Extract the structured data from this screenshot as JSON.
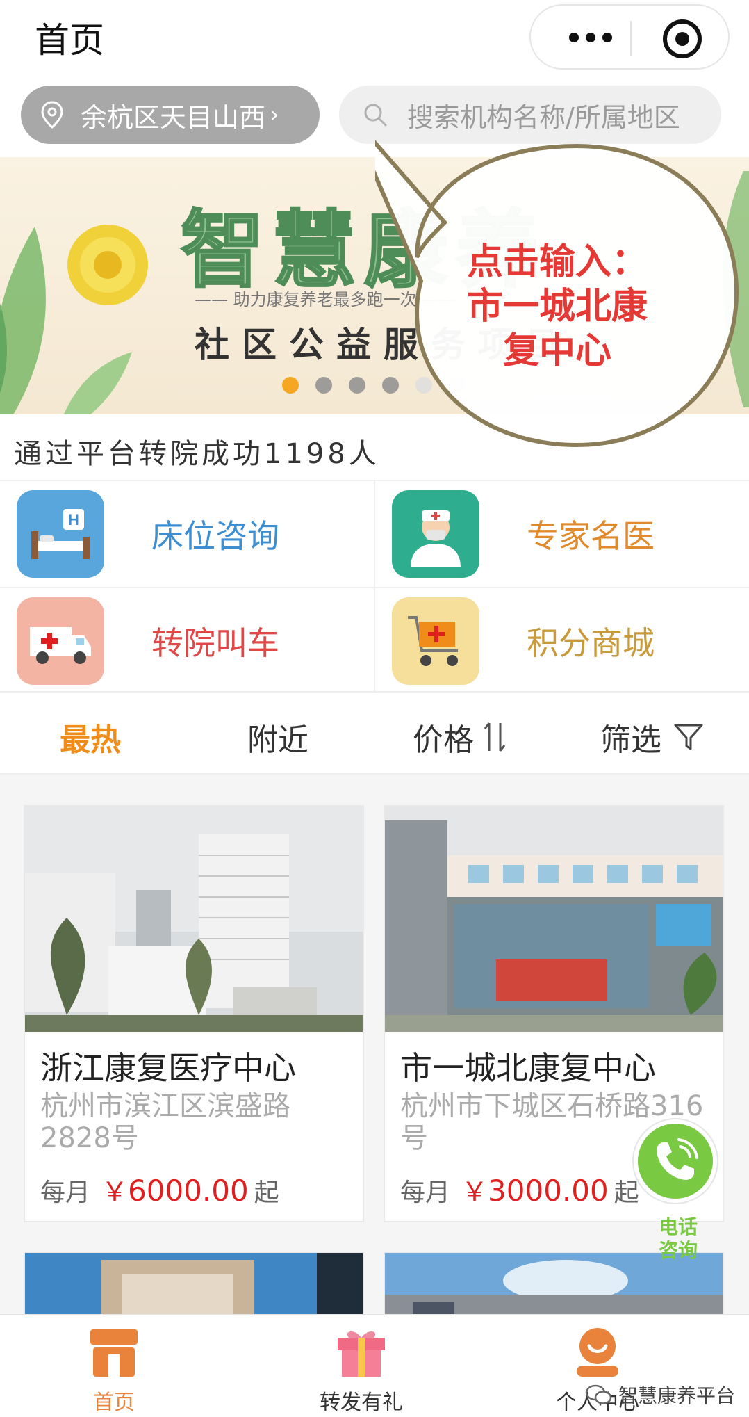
{
  "header": {
    "title": "首页",
    "location": "余杭区天目山西",
    "search_placeholder": "搜索机构名称/所属地区"
  },
  "banner": {
    "title": "智慧康养",
    "subtitle": "—— 助力康复养老最多跑一次 ——",
    "project": "社区公益服务项目",
    "callout_line1": "点击输入：",
    "callout_line2": "市一城北康",
    "callout_line3": "复中心",
    "slide_count": 6,
    "active_slide": 1
  },
  "stats": {
    "transfer_text": "通过平台转院成功1198人"
  },
  "services": [
    {
      "label": "床位咨询",
      "color": "#3d8fd1",
      "icon": "hospital-bed-icon"
    },
    {
      "label": "专家名医",
      "color": "#e08a2e",
      "icon": "doctor-icon"
    },
    {
      "label": "转院叫车",
      "color": "#e04848",
      "icon": "ambulance-icon"
    },
    {
      "label": "积分商城",
      "color": "#c89a3a",
      "icon": "shopping-cart-icon"
    }
  ],
  "sort": {
    "hot": "最热",
    "nearby": "附近",
    "price": "价格",
    "filter": "筛选"
  },
  "cards": [
    {
      "name": "浙江康复医疗中心",
      "address": "杭州市滨江区滨盛路2828号",
      "price_prefix": "每月",
      "currency": "￥",
      "price": "6000.00",
      "price_suffix": "起"
    },
    {
      "name": "市一城北康复中心",
      "address": "杭州市下城区石桥路316号",
      "price_prefix": "每月",
      "currency": "￥",
      "price": "3000.00",
      "price_suffix": "起"
    }
  ],
  "phone_consult": "电话咨询",
  "tabbar": {
    "home": "首页",
    "share": "转发有礼",
    "profile": "个人中心"
  },
  "watermark": "智慧康养平台",
  "colors": {
    "accent": "#f08c1a",
    "price": "#e02020",
    "green": "#7ac943"
  }
}
